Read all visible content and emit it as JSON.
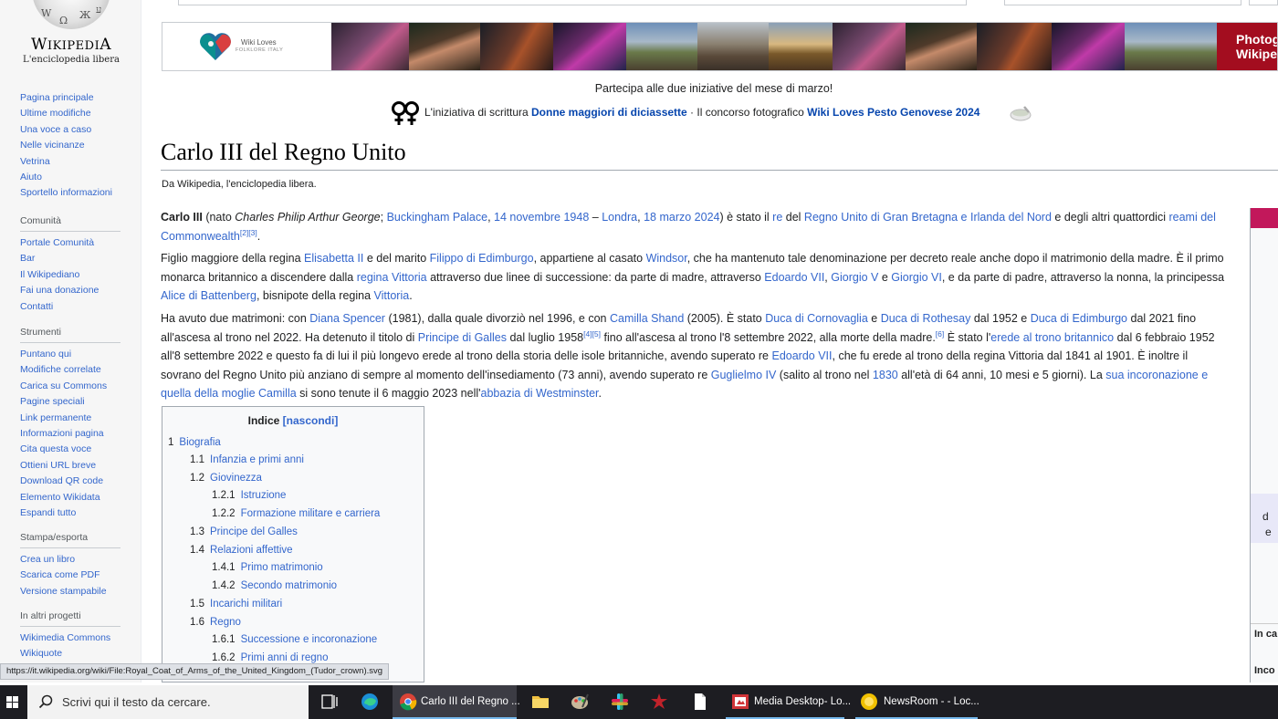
{
  "logo": {
    "wordmark": "Wikipedia",
    "tagline": "L'enciclopedia libera"
  },
  "sidebar": {
    "main": [
      "Pagina principale",
      "Ultime modifiche",
      "Una voce a caso",
      "Nelle vicinanze",
      "Vetrina",
      "Aiuto",
      "Sportello informazioni"
    ],
    "community": {
      "heading": "Comunità",
      "items": [
        "Portale Comunità",
        "Bar",
        "Il Wikipediano",
        "Fai una donazione",
        "Contatti"
      ]
    },
    "tools": {
      "heading": "Strumenti",
      "items": [
        "Puntano qui",
        "Modifiche correlate",
        "Carica su Commons",
        "Pagine speciali",
        "Link permanente",
        "Informazioni pagina",
        "Cita questa voce",
        "Ottieni URL breve",
        "Download QR code",
        "Elemento Wikidata",
        "Espandi tutto"
      ]
    },
    "print": {
      "heading": "Stampa/esporta",
      "items": [
        "Crea un libro",
        "Scarica come PDF",
        "Versione stampabile"
      ]
    },
    "projects": {
      "heading": "In altri progetti",
      "items": [
        "Wikimedia Commons",
        "Wikiquote"
      ]
    }
  },
  "banner": {
    "logo_line1": "Wiki Loves",
    "logo_line2": "FOLKLORE ITALY",
    "cta": "Photog\nWikipe"
  },
  "notice": {
    "line1": "Partecipa alle due iniziative del mese di marzo!",
    "pre": "L'iniziativa di scrittura ",
    "link1": "Donne maggiori di diciassette",
    "mid": " · Il concorso fotografico ",
    "link2": "Wiki Loves Pesto Genovese 2024"
  },
  "article": {
    "title": "Carlo III del Regno Unito",
    "tagline": "Da Wikipedia, l'enciclopedia libera."
  },
  "infobox": {
    "frag_d": "d",
    "frag_e": "e",
    "frag_inca": "In ca",
    "frag_inco": "Inco"
  },
  "toc": {
    "title": "Indice",
    "toggle": "[nascondi]",
    "items": [
      {
        "num": "1",
        "label": "Biografia"
      },
      {
        "num": "1.1",
        "label": "Infanzia e primi anni"
      },
      {
        "num": "1.2",
        "label": "Giovinezza"
      },
      {
        "num": "1.2.1",
        "label": "Istruzione"
      },
      {
        "num": "1.2.2",
        "label": "Formazione militare e carriera"
      },
      {
        "num": "1.3",
        "label": "Principe del Galles"
      },
      {
        "num": "1.4",
        "label": "Relazioni affettive"
      },
      {
        "num": "1.4.1",
        "label": "Primo matrimonio"
      },
      {
        "num": "1.4.2",
        "label": "Secondo matrimonio"
      },
      {
        "num": "1.5",
        "label": "Incarichi militari"
      },
      {
        "num": "1.6",
        "label": "Regno"
      },
      {
        "num": "1.6.1",
        "label": "Successione e incoronazione"
      },
      {
        "num": "1.6.2",
        "label": "Primi anni di regno"
      }
    ]
  },
  "statusbar": {
    "url": "https://it.wikipedia.org/wiki/File:Royal_Coat_of_Arms_of_the_United_Kingdom_(Tudor_crown).svg"
  },
  "taskbar": {
    "search_placeholder": "Scrivi qui il testo da cercare.",
    "apps": [
      "Carlo III del Regno ...",
      "Media Desktop- Lo...",
      "NewsRoom - - Loc..."
    ]
  },
  "colors": {
    "link": "#3366cc",
    "banner_cta": "#a30d1f",
    "infobox_header": "#c2185b",
    "taskbar": "#1d1d22"
  }
}
